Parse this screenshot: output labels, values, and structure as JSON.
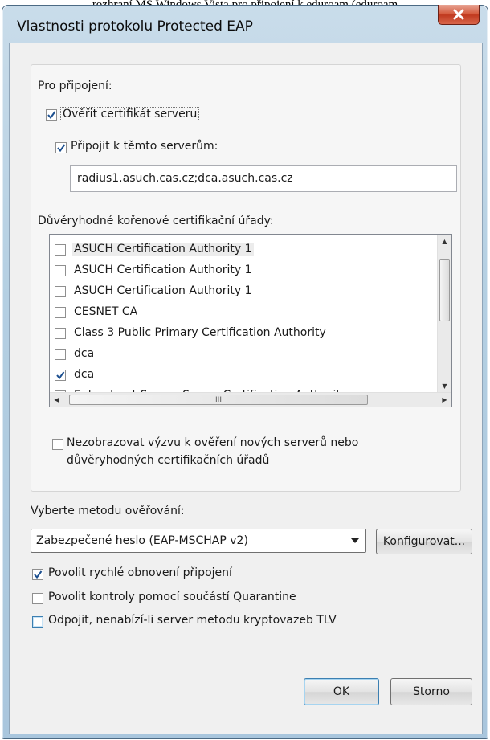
{
  "background_caption": "rozhraní MS Windows Vista pro připojení k eduroam (eduroam",
  "window": {
    "title": "Vlastnosti protokolu Protected EAP"
  },
  "connection_group": {
    "label": "Pro připojení:",
    "verify_cert": {
      "label": "Ověřit certifikát serveru",
      "checked": true
    },
    "connect_servers": {
      "label": "Připojit k těmto serverům:",
      "checked": true
    },
    "servers_value": "radius1.asuch.cas.cz;dca.asuch.cas.cz",
    "trusted_ca_label": "Důvěryhodné kořenové certifikační úřady:",
    "ca_list": [
      {
        "label": "ASUCH Certification Authority 1",
        "checked": false
      },
      {
        "label": "ASUCH Certification Authority 1",
        "checked": false
      },
      {
        "label": "ASUCH Certification Authority 1",
        "checked": false
      },
      {
        "label": "CESNET CA",
        "checked": false
      },
      {
        "label": "Class 3 Public Primary Certification Authority",
        "checked": false
      },
      {
        "label": "dca",
        "checked": false
      },
      {
        "label": "dca",
        "checked": true
      },
      {
        "label": "Entrust.net Secure Server Certification Authority",
        "checked": false
      }
    ],
    "hscroll_thumb_glyph": "III",
    "no_prompt": {
      "label_line1": "Nezobrazovat výzvu k ověření nových serverů nebo",
      "label_line2": "důvěryhodných certifikačních úřadů",
      "checked": false
    }
  },
  "auth_method": {
    "label": "Vyberte metodu ověřování:",
    "selected": "Zabezpečené heslo (EAP-MSCHAP v2)",
    "configure_label": "Konfigurovat..."
  },
  "options": {
    "fast_reconnect": {
      "label": "Povolit rychlé obnovení připojení",
      "checked": true
    },
    "quarantine": {
      "label": "Povolit kontroly pomocí součástí Quarantine",
      "checked": false
    },
    "disconnect_tlv": {
      "label": "Odpojit, nenabízí-li server metodu kryptovazeb TLV",
      "checked": false
    }
  },
  "buttons": {
    "ok": "OK",
    "cancel": "Storno"
  },
  "colors": {
    "accent": "#3c7fb1",
    "close": "#c0391e",
    "check": "#1c4f8f"
  }
}
